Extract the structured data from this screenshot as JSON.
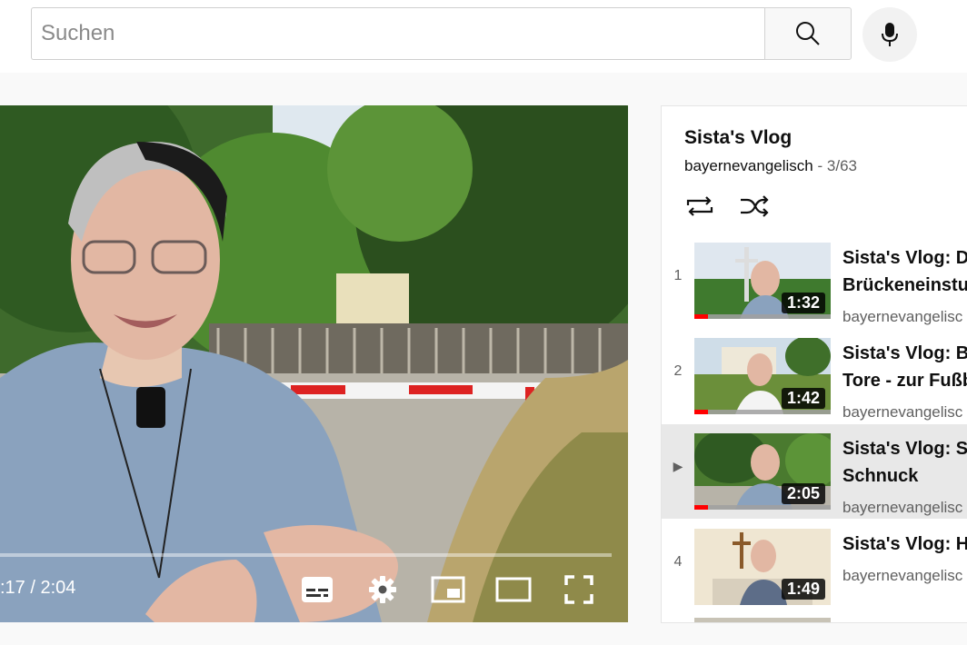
{
  "search": {
    "placeholder": "Suchen",
    "icon": "search-icon"
  },
  "mic": {
    "icon": "microphone-icon"
  },
  "player": {
    "time": ":17 / 2:04",
    "progress_fraction": 0.14,
    "controls": [
      "subtitles-icon",
      "settings-icon",
      "miniplayer-icon",
      "theater-mode-icon",
      "fullscreen-icon"
    ]
  },
  "playlist": {
    "title": "Sista's Vlog",
    "owner": "bayernevangelisch",
    "separator": "-",
    "position": "3/63",
    "items": [
      {
        "index": "1",
        "title_line1": "Sista's Vlog: Dr",
        "title_line2": "Brückeneinstur",
        "channel": "bayernevangelisc",
        "duration": "1:32",
        "watched": 0.1,
        "active": false
      },
      {
        "index": "2",
        "title_line1": "Sista's Vlog: Ba",
        "title_line2": "Tore - zur Fußb",
        "channel": "bayernevangelisc",
        "duration": "1:42",
        "watched": 0.1,
        "active": false
      },
      {
        "index": "▶",
        "title_line1": "Sista's Vlog: Sc",
        "title_line2": "Schnuck",
        "channel": "bayernevangelisc",
        "duration": "2:05",
        "watched": 0.1,
        "active": true
      },
      {
        "index": "4",
        "title_line1": "Sista's Vlog: Hi",
        "title_line2": "",
        "channel": "bayernevangelisc",
        "duration": "1:49",
        "watched": 0,
        "active": false
      }
    ]
  },
  "colors": {
    "accent_red": "#ff0000",
    "active_row": "#e8e8e8"
  }
}
